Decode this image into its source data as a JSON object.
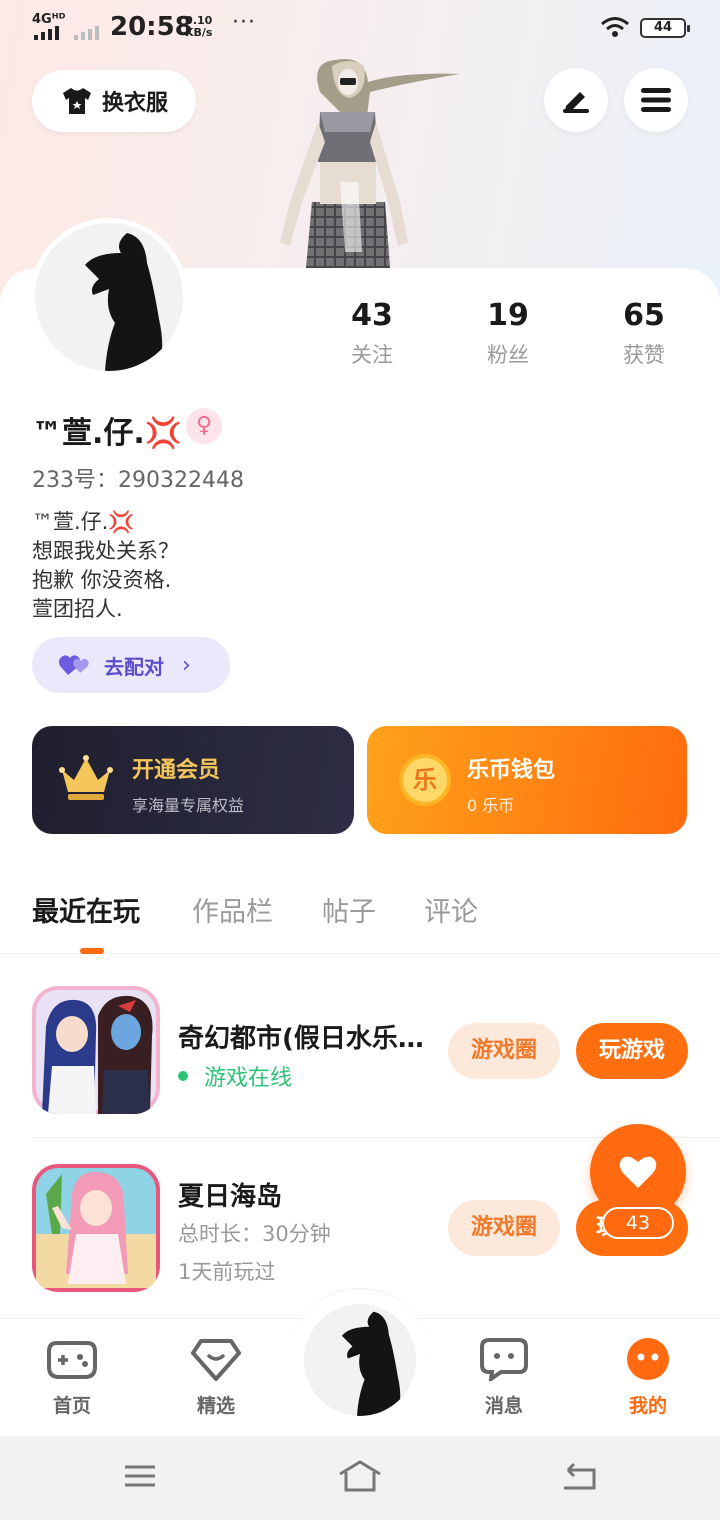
{
  "status_bar": {
    "network": "4Gᴴᴰ",
    "time": "20:58",
    "speed_value": "0.10",
    "speed_unit": "KB/s",
    "more": "···",
    "battery": "44"
  },
  "header": {
    "outfit_label": "换衣服",
    "edit_icon": "pen-icon",
    "menu_icon": "hamburger-menu-icon"
  },
  "stats": [
    {
      "value": "43",
      "label": "关注"
    },
    {
      "value": "19",
      "label": "粉丝"
    },
    {
      "value": "65",
      "label": "获赞"
    }
  ],
  "profile": {
    "nickname": "™萱.仔.💢",
    "gender_symbol": "♀",
    "uid": "233号：290322448",
    "bio_lines": [
      "™萱.仔.💢",
      "想跟我处关系？",
      "抱歉 你没资格.",
      "萱团招人."
    ],
    "match_label": "去配对",
    "match_chevron": "›"
  },
  "vip": {
    "title": "开通会员",
    "subtitle": "享海量专属权益",
    "icon": "crown-icon"
  },
  "wallet": {
    "title": "乐币钱包",
    "subtitle": "0 乐币",
    "coin_glyph": "乐"
  },
  "tabs": [
    "最近在玩",
    "作品栏",
    "帖子",
    "评论"
  ],
  "games": [
    {
      "title": "奇幻都市(假日水乐…",
      "status": "游戏在线",
      "circle_label": "游戏圈",
      "play_label": "玩游戏"
    },
    {
      "title": "夏日海岛",
      "duration": "总时长：30分钟",
      "last_played": "1天前玩过",
      "circle_label": "游戏圈",
      "play_label_partial": "玩"
    }
  ],
  "like_fab": {
    "count": "43",
    "icon": "heart-icon"
  },
  "bottom_nav": [
    {
      "label": "首页",
      "icon": "gamepad-icon"
    },
    {
      "label": "精选",
      "icon": "heart-box-icon"
    },
    {
      "label": "消息",
      "icon": "chat-bubble-icon"
    },
    {
      "label": "我的",
      "icon": "face-icon"
    }
  ],
  "colors": {
    "accent": "#ff6a10",
    "online_green": "#2fc37a",
    "match_purple": "#5b4fc9",
    "vip_gold": "#f5c75a"
  }
}
